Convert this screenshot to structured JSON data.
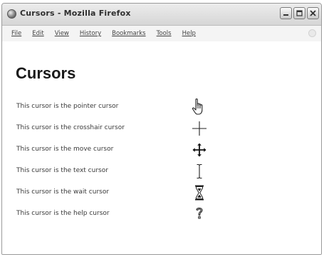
{
  "window": {
    "title": "Cursors - Mozilla Firefox"
  },
  "menubar": {
    "items": [
      {
        "label": "File"
      },
      {
        "label": "Edit"
      },
      {
        "label": "View"
      },
      {
        "label": "History"
      },
      {
        "label": "Bookmarks"
      },
      {
        "label": "Tools"
      },
      {
        "label": "Help"
      }
    ]
  },
  "page": {
    "heading": "Cursors",
    "rows": [
      {
        "text": "This cursor is the pointer cursor",
        "icon": "pointer-hand-icon"
      },
      {
        "text": "This cursor is the crosshair cursor",
        "icon": "crosshair-icon"
      },
      {
        "text": "This cursor is the move cursor",
        "icon": "move-icon"
      },
      {
        "text": "This cursor is the text cursor",
        "icon": "text-ibeam-icon"
      },
      {
        "text": "This cursor is the wait cursor",
        "icon": "hourglass-icon"
      },
      {
        "text": "This cursor is the help cursor",
        "icon": "help-icon"
      }
    ]
  }
}
